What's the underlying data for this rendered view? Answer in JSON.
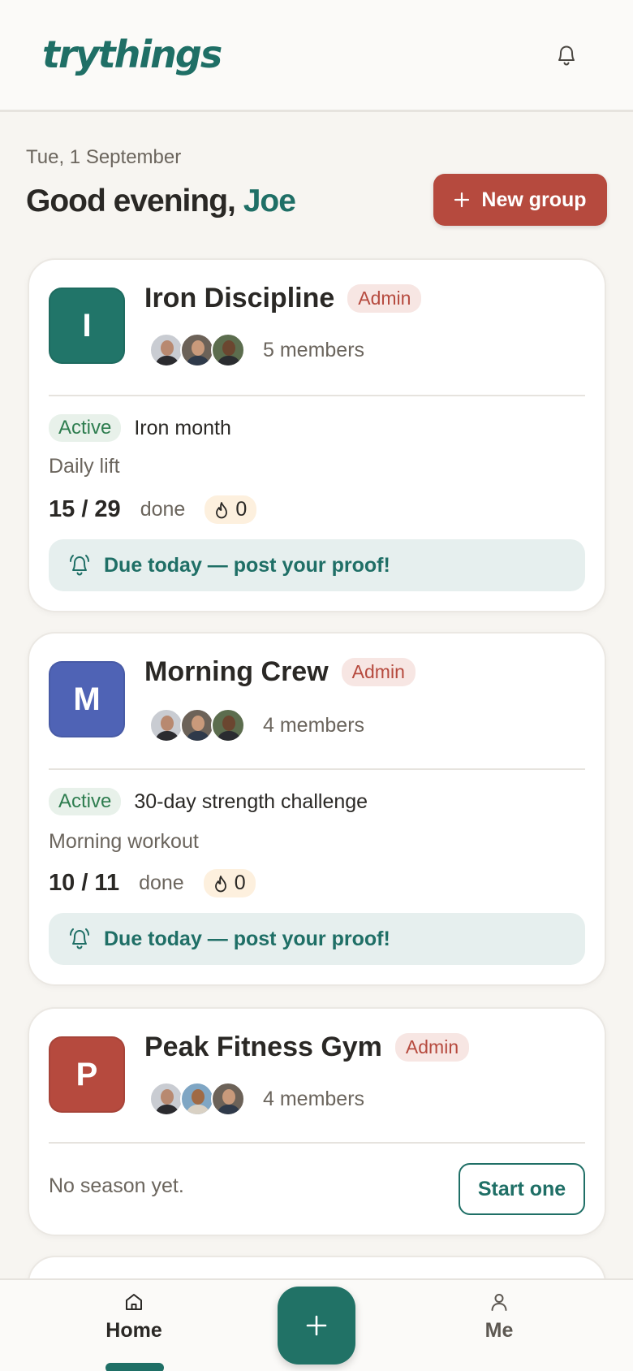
{
  "header": {
    "logo": "trythings",
    "notifications_icon": "bell-icon"
  },
  "hero": {
    "date": "Tue, 1 September",
    "greeting": "Good evening,",
    "user_name": "Joe",
    "new_group_label": "New group"
  },
  "groups": [
    {
      "initial": "I",
      "color": "#217569",
      "name": "Iron Discipline",
      "role": "Admin",
      "members_label": "5 members",
      "season_status": "Active",
      "season_name": "Iron month",
      "task": "Daily lift",
      "progress": "15 / 29",
      "done_label": "done",
      "streak": "0",
      "due_message": "Due today — post your proof!"
    },
    {
      "initial": "M",
      "color": "#4f63b5",
      "name": "Morning Crew",
      "role": "Admin",
      "members_label": "4 members",
      "season_status": "Active",
      "season_name": "30-day strength challenge",
      "task": "Morning workout",
      "progress": "10 / 11",
      "done_label": "done",
      "streak": "0",
      "due_message": "Due today — post your proof!"
    },
    {
      "initial": "P",
      "color": "#b64a3e",
      "name": "Peak Fitness Gym",
      "role": "Admin",
      "members_label": "4 members",
      "no_season": "No season yet.",
      "start_label": "Start one"
    }
  ],
  "bottom_nav": {
    "home_label": "Home",
    "me_label": "Me",
    "fab_icon": "plus-icon"
  },
  "colors": {
    "brand": "#1f6f66",
    "accent": "#b64a3e",
    "background": "#f7f5f1"
  }
}
